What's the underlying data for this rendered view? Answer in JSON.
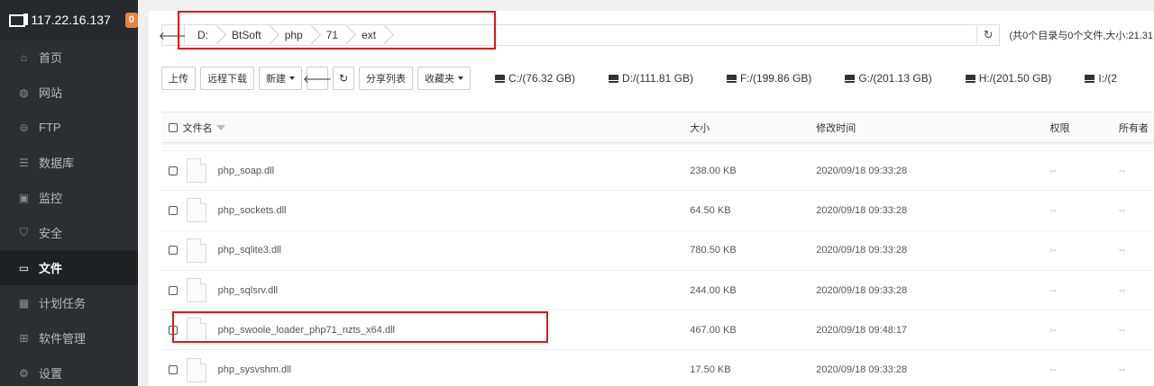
{
  "sidebar": {
    "server_ip": "117.22.16.137",
    "badge_count": "0",
    "items": [
      {
        "label": "首页",
        "icon": "home-icon",
        "glyph": "⌂"
      },
      {
        "label": "网站",
        "icon": "globe-icon",
        "glyph": "◍"
      },
      {
        "label": "FTP",
        "icon": "ftp-icon",
        "glyph": "⊜"
      },
      {
        "label": "数据库",
        "icon": "database-icon",
        "glyph": "☰"
      },
      {
        "label": "监控",
        "icon": "monitor-icon",
        "glyph": "▣"
      },
      {
        "label": "安全",
        "icon": "shield-icon",
        "glyph": "⛉"
      },
      {
        "label": "文件",
        "icon": "folder-icon",
        "glyph": "▭",
        "active": true
      },
      {
        "label": "计划任务",
        "icon": "calendar-icon",
        "glyph": "▦"
      },
      {
        "label": "软件管理",
        "icon": "apps-icon",
        "glyph": "⊞"
      },
      {
        "label": "设置",
        "icon": "gear-icon",
        "glyph": "⚙"
      }
    ]
  },
  "path": {
    "crumbs": [
      "D:",
      "BtSoft",
      "php",
      "71",
      "ext"
    ],
    "dir_info": "(共0个目录与0个文件,大小:21.31"
  },
  "toolbar": {
    "upload": "上传",
    "remote_download": "远程下载",
    "new": "新建",
    "share_list": "分享列表",
    "favorites": "收藏夹"
  },
  "disks": [
    "C:/(76.32 GB)",
    "D:/(111.81 GB)",
    "F:/(199.86 GB)",
    "G:/(201.13 GB)",
    "H:/(201.50 GB)",
    "I:/(2"
  ],
  "table": {
    "headers": {
      "name": "文件名",
      "size": "大小",
      "time": "修改时间",
      "perm": "权限",
      "owner": "所有者"
    },
    "rows": [
      {
        "name": "php_soap.dll",
        "size": "238.00 KB",
        "time": "2020/09/18 09:33:28",
        "perm": "--",
        "owner": "--"
      },
      {
        "name": "php_sockets.dll",
        "size": "64.50 KB",
        "time": "2020/09/18 09:33:28",
        "perm": "--",
        "owner": "--"
      },
      {
        "name": "php_sqlite3.dll",
        "size": "780.50 KB",
        "time": "2020/09/18 09:33:28",
        "perm": "--",
        "owner": "--"
      },
      {
        "name": "php_sqlsrv.dll",
        "size": "244.00 KB",
        "time": "2020/09/18 09:33:28",
        "perm": "--",
        "owner": "--"
      },
      {
        "name": "php_swoole_loader_php71_nzts_x64.dll",
        "size": "467.00 KB",
        "time": "2020/09/18 09:48:17",
        "perm": "--",
        "owner": "--"
      },
      {
        "name": "php_sysvshm.dll",
        "size": "17.50 KB",
        "time": "2020/09/18 09:33:28",
        "perm": "--",
        "owner": "--"
      }
    ]
  },
  "colors": {
    "highlight": "#e0161b",
    "sidebar_bg": "#2b2f33",
    "badge": "#f0803c"
  }
}
